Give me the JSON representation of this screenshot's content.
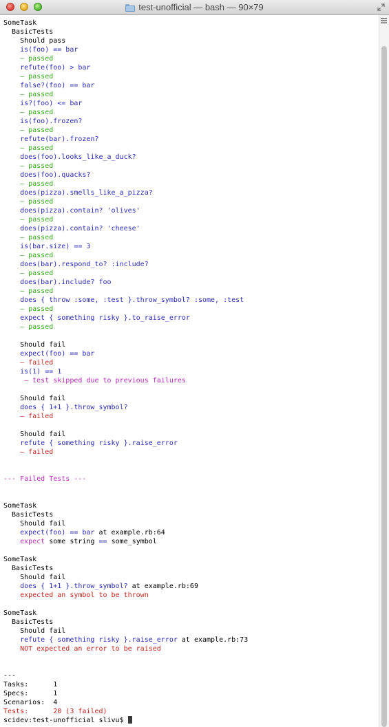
{
  "window": {
    "title": "test-unofficial — bash — 90×79",
    "title_icon": "folder-icon"
  },
  "colors": {
    "default": "#000000",
    "blue": "#2b2bb5",
    "green": "#38a81c",
    "red": "#c0281f",
    "magenta": "#b52cb5"
  },
  "terminal": {
    "lines": [
      [
        {
          "t": "SomeTask",
          "c": "default"
        }
      ],
      [
        {
          "t": "  BasicTests",
          "c": "default"
        }
      ],
      [
        {
          "t": "    Should pass",
          "c": "default"
        }
      ],
      [
        {
          "t": "    is(foo) == bar",
          "c": "blue"
        }
      ],
      [
        {
          "t": "    – passed",
          "c": "green"
        }
      ],
      [
        {
          "t": "    refute(foo) > bar",
          "c": "blue"
        }
      ],
      [
        {
          "t": "    – passed",
          "c": "green"
        }
      ],
      [
        {
          "t": "    false?(foo) == bar",
          "c": "blue"
        }
      ],
      [
        {
          "t": "    – passed",
          "c": "green"
        }
      ],
      [
        {
          "t": "    is?(foo) <= bar",
          "c": "blue"
        }
      ],
      [
        {
          "t": "    – passed",
          "c": "green"
        }
      ],
      [
        {
          "t": "    is(foo).frozen?",
          "c": "blue"
        }
      ],
      [
        {
          "t": "    – passed",
          "c": "green"
        }
      ],
      [
        {
          "t": "    refute(bar).frozen?",
          "c": "blue"
        }
      ],
      [
        {
          "t": "    – passed",
          "c": "green"
        }
      ],
      [
        {
          "t": "    does(foo).looks_like_a_duck?",
          "c": "blue"
        }
      ],
      [
        {
          "t": "    – passed",
          "c": "green"
        }
      ],
      [
        {
          "t": "    does(foo).quacks?",
          "c": "blue"
        }
      ],
      [
        {
          "t": "    – passed",
          "c": "green"
        }
      ],
      [
        {
          "t": "    does(pizza).smells_like_a_pizza?",
          "c": "blue"
        }
      ],
      [
        {
          "t": "    – passed",
          "c": "green"
        }
      ],
      [
        {
          "t": "    does(pizza).contain? 'olives'",
          "c": "blue"
        }
      ],
      [
        {
          "t": "    – passed",
          "c": "green"
        }
      ],
      [
        {
          "t": "    does(pizza).contain? 'cheese'",
          "c": "blue"
        }
      ],
      [
        {
          "t": "    – passed",
          "c": "green"
        }
      ],
      [
        {
          "t": "    is(bar.size) == 3",
          "c": "blue"
        }
      ],
      [
        {
          "t": "    – passed",
          "c": "green"
        }
      ],
      [
        {
          "t": "    does(bar).respond_to? :include?",
          "c": "blue"
        }
      ],
      [
        {
          "t": "    – passed",
          "c": "green"
        }
      ],
      [
        {
          "t": "    does(bar).include? foo",
          "c": "blue"
        }
      ],
      [
        {
          "t": "    – passed",
          "c": "green"
        }
      ],
      [
        {
          "t": "    does { throw :some, :test }.throw_symbol? :some, :test",
          "c": "blue"
        }
      ],
      [
        {
          "t": "    – passed",
          "c": "green"
        }
      ],
      [
        {
          "t": "    expect { something risky }.to_raise_error",
          "c": "blue"
        }
      ],
      [
        {
          "t": "    – passed",
          "c": "green"
        }
      ],
      [],
      [
        {
          "t": "    Should fail",
          "c": "default"
        }
      ],
      [
        {
          "t": "    expect(foo) == bar",
          "c": "blue"
        }
      ],
      [
        {
          "t": "    – failed",
          "c": "red"
        }
      ],
      [
        {
          "t": "    is(1) == 1",
          "c": "blue"
        }
      ],
      [
        {
          "t": "     – test skipped due to previous failures",
          "c": "magenta"
        }
      ],
      [],
      [
        {
          "t": "    Should fail",
          "c": "default"
        }
      ],
      [
        {
          "t": "    does { 1+1 }.throw_symbol?",
          "c": "blue"
        }
      ],
      [
        {
          "t": "    – failed",
          "c": "red"
        }
      ],
      [],
      [
        {
          "t": "    Should fail",
          "c": "default"
        }
      ],
      [
        {
          "t": "    refute { something risky }.raise_error",
          "c": "blue"
        }
      ],
      [
        {
          "t": "    – failed",
          "c": "red"
        }
      ],
      [],
      [],
      [
        {
          "t": "--- Failed Tests ---",
          "c": "magenta"
        }
      ],
      [],
      [],
      [
        {
          "t": "SomeTask",
          "c": "default"
        }
      ],
      [
        {
          "t": "  BasicTests",
          "c": "default"
        }
      ],
      [
        {
          "t": "    Should fail",
          "c": "default"
        }
      ],
      [
        {
          "t": "    expect(foo) == bar",
          "c": "blue"
        },
        {
          "t": " at example.rb:64",
          "c": "default"
        }
      ],
      [
        {
          "t": "    expect",
          "c": "magenta"
        },
        {
          "t": " some string ",
          "c": "default"
        },
        {
          "t": "==",
          "c": "blue"
        },
        {
          "t": " some_symbol",
          "c": "default"
        }
      ],
      [],
      [
        {
          "t": "SomeTask",
          "c": "default"
        }
      ],
      [
        {
          "t": "  BasicTests",
          "c": "default"
        }
      ],
      [
        {
          "t": "    Should fail",
          "c": "default"
        }
      ],
      [
        {
          "t": "    does { 1+1 }.throw_symbol?",
          "c": "blue"
        },
        {
          "t": " at example.rb:69",
          "c": "default"
        }
      ],
      [
        {
          "t": "    expected an symbol to be thrown",
          "c": "red"
        }
      ],
      [],
      [
        {
          "t": "SomeTask",
          "c": "default"
        }
      ],
      [
        {
          "t": "  BasicTests",
          "c": "default"
        }
      ],
      [
        {
          "t": "    Should fail",
          "c": "default"
        }
      ],
      [
        {
          "t": "    refute { something risky }.raise_error",
          "c": "blue"
        },
        {
          "t": " at example.rb:73",
          "c": "default"
        }
      ],
      [
        {
          "t": "    NOT expected an error to be raised",
          "c": "red"
        }
      ],
      [],
      [],
      [
        {
          "t": "---",
          "c": "default"
        }
      ],
      [
        {
          "t": "Tasks:      1",
          "c": "default"
        }
      ],
      [
        {
          "t": "Specs:      1",
          "c": "default"
        }
      ],
      [
        {
          "t": "Scenarios:  4",
          "c": "default"
        }
      ],
      [
        {
          "t": "Tests:      20 (3 failed)",
          "c": "red"
        }
      ]
    ],
    "prompt": "scidev:test-unofficial slivu$ "
  }
}
